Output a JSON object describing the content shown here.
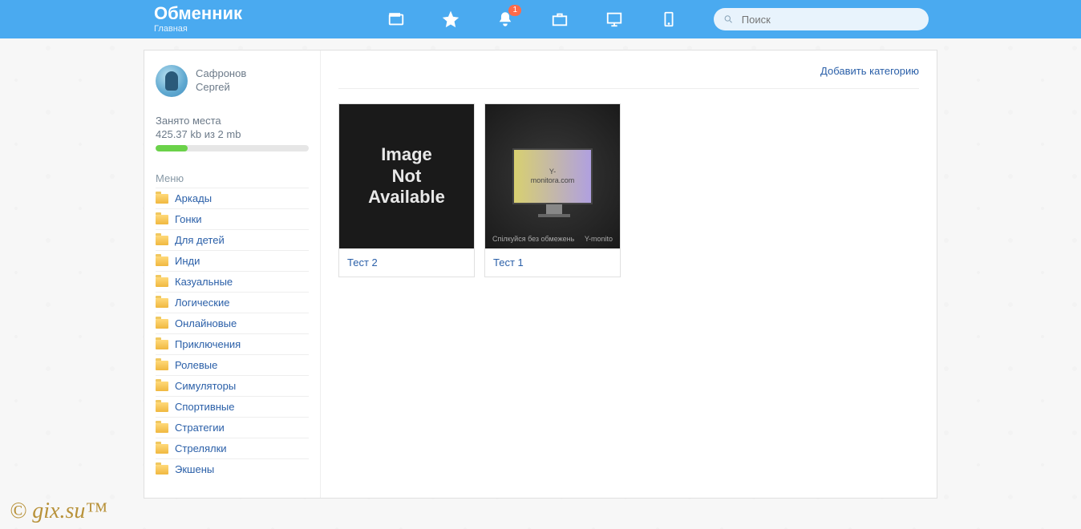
{
  "header": {
    "title": "Обменник",
    "subtitle": "Главная",
    "notification_count": "1",
    "search_placeholder": "Поиск"
  },
  "sidebar": {
    "profile": {
      "first_name": "Сафронов",
      "last_name": "Сергей"
    },
    "storage": {
      "label": "Занято места",
      "value": "425.37 kb из 2 mb",
      "percent": 21
    },
    "menu_title": "Меню",
    "menu": [
      {
        "label": "Аркады"
      },
      {
        "label": "Гонки"
      },
      {
        "label": "Для детей"
      },
      {
        "label": "Инди"
      },
      {
        "label": "Казуальные"
      },
      {
        "label": "Логические"
      },
      {
        "label": "Онлайновые"
      },
      {
        "label": "Приключения"
      },
      {
        "label": "Ролевые"
      },
      {
        "label": "Симуляторы"
      },
      {
        "label": "Спортивные"
      },
      {
        "label": "Стратегии"
      },
      {
        "label": "Стрелялки"
      },
      {
        "label": "Экшены"
      }
    ]
  },
  "main": {
    "add_category_label": "Добавить категорию",
    "cards": [
      {
        "title": "Тест 2",
        "image_placeholder": "Image Not Available"
      },
      {
        "title": "Тест 1",
        "monitor_text": "Y-monitora.com",
        "caption_left": "Спілкуйся без обмежень",
        "caption_right": "Y-monito"
      }
    ]
  },
  "watermark": "© gix.su™"
}
